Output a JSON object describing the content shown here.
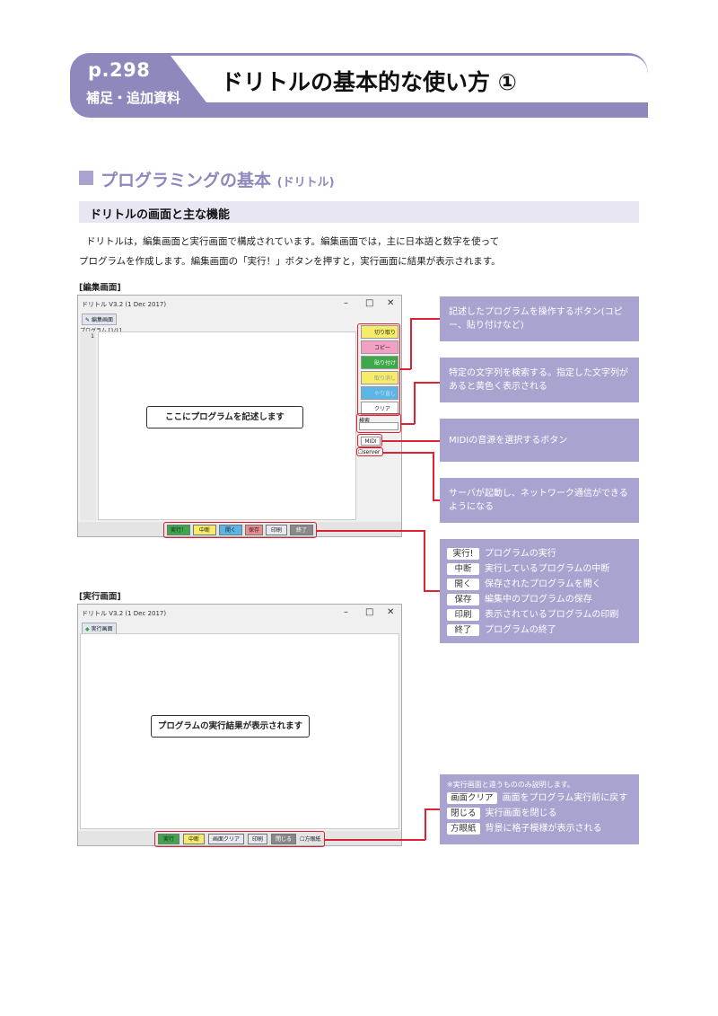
{
  "header": {
    "page": "p.298",
    "sub": "補足・追加資料",
    "title": "ドリトルの基本的な使い方 ①"
  },
  "section": {
    "title": "プログラミングの基本",
    "title_small": "(ドリトル)",
    "subtitle": "ドリトルの画面と主な機能"
  },
  "intro": [
    "ドリトルは，編集画面と実行画面で構成されています。編集画面では，主に日本語と数字を使って",
    "プログラムを作成します。編集画面の「実行！」ボタンを押すと，実行画面に結果が表示されます。"
  ],
  "edit": {
    "label": "[編集画面]",
    "window_title": "ドリトル V3.2 (1 Dec 2017)",
    "tab": "編集画面",
    "program_label": "プログラム [1/1]",
    "line_no": "1",
    "callout": "ここにプログラムを記述します",
    "side_buttons": [
      "切り取り",
      "コピー",
      "貼り付け",
      "取り消し",
      "やり直し",
      "クリア"
    ],
    "search_label": "検索",
    "midi": "MIDI",
    "server": "server",
    "bottom_buttons": [
      "実行！",
      "中断",
      "開く",
      "保存",
      "印刷",
      "終了"
    ]
  },
  "run": {
    "label": "[実行画面]",
    "window_title": "ドリトル V3.2 (1 Dec 2017)",
    "tab": "実行画面",
    "callout": "プログラムの実行結果が表示されます",
    "bottom_buttons": [
      "実行",
      "中断",
      "画面クリア",
      "印刷",
      "閉じる"
    ],
    "checkbox": "方眼紙"
  },
  "notes": {
    "n1": "記述したプログラムを操作するボタン(コピー、貼り付けなど)",
    "n2": "特定の文字列を検索する。指定した文字列があると黄色く表示される",
    "n3": "MIDIの音源を選択するボタン",
    "n4": "サーバが起動し、ネットワーク通信ができるようになる",
    "buttons": [
      {
        "tag": "実行!",
        "desc": "プログラムの実行"
      },
      {
        "tag": "中断",
        "desc": "実行しているプログラムの中断"
      },
      {
        "tag": "開く",
        "desc": "保存されたプログラムを開く"
      },
      {
        "tag": "保存",
        "desc": "編集中のプログラムの保存"
      },
      {
        "tag": "印刷",
        "desc": "表示されているプログラムの印刷"
      },
      {
        "tag": "終了",
        "desc": "プログラムの終了"
      }
    ],
    "run_head": "※実行画面と違うもののみ説明します。",
    "run_buttons": [
      {
        "tag": "画面クリア",
        "desc": "画面をプログラム実行前に戻す"
      },
      {
        "tag": "閉じる",
        "desc": "実行画面を閉じる"
      },
      {
        "tag": "方眼紙",
        "desc": "背景に格子模様が表示される"
      }
    ]
  },
  "colors": {
    "accent": "#8e88bd",
    "panel": "#a9a3cf",
    "red": "#d23"
  }
}
